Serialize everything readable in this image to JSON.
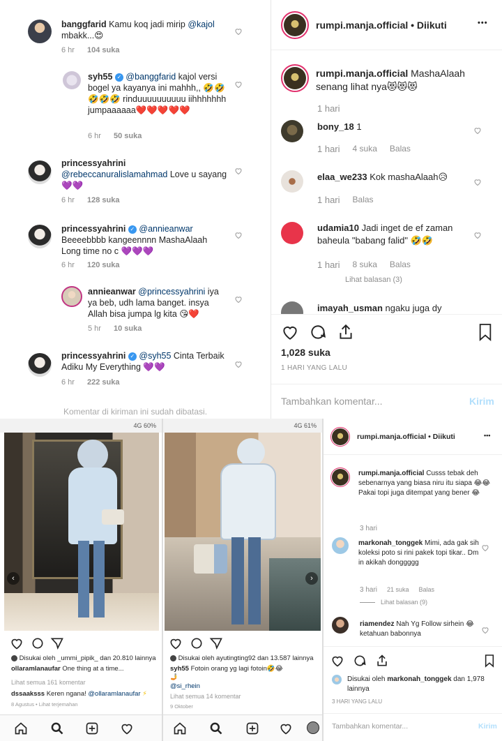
{
  "top_left": {
    "comments": [
      {
        "user": "banggfarid",
        "text": "Kamu koq jadi mirip ",
        "mention": "@kajol",
        "text2": " mbakk...😍",
        "time": "6 hr",
        "likes": "104 suka",
        "reply": ""
      },
      {
        "user": "syh55",
        "mention": "@banggfarid",
        "text": " kajol versi bogel ya kayanya ini mahhh,, 🤣🤣🤣🤣🤣 rinduuuuuuuuuu iihhhhhhh jumpaaaaaa❤️❤️❤️❤️❤️",
        "time": "6 hr",
        "likes": "50 suka"
      },
      {
        "user": "princessyahrini",
        "mention": "@rebeccanuralislamahmad",
        "text": " Love u sayang 💜💜",
        "time": "6 hr",
        "likes": "128 suka"
      },
      {
        "user": "princessyahrini",
        "mention": "@annieanwar",
        "text": " Beeeebbbb kangeennnn MashaAlaah Long time no c 💜💜💜",
        "time": "6 hr",
        "likes": "120 suka"
      },
      {
        "user": "annieanwar",
        "mention": "@princessyahrini",
        "text": " iya ya beb, udh lama banget. insya Allah bisa jumpa lg kita 😘❤️",
        "time": "5 hr",
        "likes": "10 suka"
      },
      {
        "user": "princessyahrini",
        "mention": "@syh55",
        "text": " Cinta Terbaik Adiku My Everything 💜💜",
        "time": "6 hr",
        "likes": "222 suka"
      }
    ],
    "closed_notice": "Komentar di kiriman ini sudah dibatasi."
  },
  "top_right": {
    "header_user": "rumpi.manja.official",
    "header_follow": "• Diikuti",
    "more": "•••",
    "caption_user": "rumpi.manja.official",
    "caption_text": " MashaAlaah senang lihat nya😻😻😻",
    "caption_time": "1 hari",
    "comments": [
      {
        "user": "bony_18",
        "text": " 1",
        "time": "1 hari",
        "likes": "4 suka",
        "reply": "Balas"
      },
      {
        "user": "elaa_we233",
        "text": " Kok mashaAlaah😥",
        "time": "1 hari",
        "likes": "",
        "reply": "Balas"
      },
      {
        "user": "udamia10",
        "text": " Jadi inget de ef zaman baheula \"babang falid\" 🤣🤣",
        "time": "1 hari",
        "likes": "8 suka",
        "reply": "Balas"
      },
      {
        "user": "imayah_usman",
        "text": " ngaku juga dy",
        "time": "",
        "likes": "",
        "reply": ""
      }
    ],
    "view_replies": "Lihat balasan (3)",
    "likes_count": "1,028 suka",
    "date": "1 HARI YANG LALU",
    "add_comment_placeholder": "Tambahkan komentar...",
    "post_label": "Kirim"
  },
  "bottom_left": {
    "status": "4G 60%",
    "liked_by": "Disukai oleh _ummi_pipik_ dan 20.810 lainnya",
    "caption_user": "ollaramlanaufar",
    "caption_text": " One thing at a time...",
    "view_all": "Lihat semua 161 komentar",
    "comment_user": "dssaaksss",
    "comment_text": " Keren ngana! ",
    "comment_mention": "@ollaramlanaufar",
    "comment_emoji": "⚡",
    "date": "8 Agustus • Lihat terjemahan"
  },
  "bottom_mid": {
    "status": "4G 61%",
    "liked_by": "Disukai oleh ayutingting92 dan 13.587 lainnya",
    "caption_user": "syh55",
    "caption_text": " Fotoin orang yg lagi fotoin🤣😂",
    "mention": "@si_rhein",
    "view_all": "Lihat semua 14 komentar",
    "date": "9 Oktober"
  },
  "bottom_right": {
    "header_user": "rumpi.manja.official",
    "header_follow": "• Diikuti",
    "more": "•••",
    "caption_user": "rumpi.manja.official",
    "caption_text": " Cusss tebak deh sebenarnya yang biasa niru itu siapa 😂😂",
    "caption_text2": "Pakai topi juga ditempat yang bener 😂",
    "caption_time": "3 hari",
    "c1_user": "markonah_tonggek",
    "c1_text": " Mimi, ada gak sih koleksi poto si rini pakek topi tikar.. Dm in akikah donggggg",
    "c1_time": "3 hari",
    "c1_likes": "21 suka",
    "c1_reply": "Balas",
    "c1_view": "Lihat balasan (9)",
    "c2_user": "riamendez",
    "c2_text": " Nah Yg Follow sirhein 😂 ketahuan babonnya",
    "liked_by_user": "markonah_tonggek",
    "liked_by_text": "Disukai oleh",
    "liked_by_rest": "dan 1,978 lainnya",
    "date": "3 HARI YANG LALU",
    "add_comment_placeholder": "Tambahkan komentar...",
    "post_label": "Kirim"
  }
}
